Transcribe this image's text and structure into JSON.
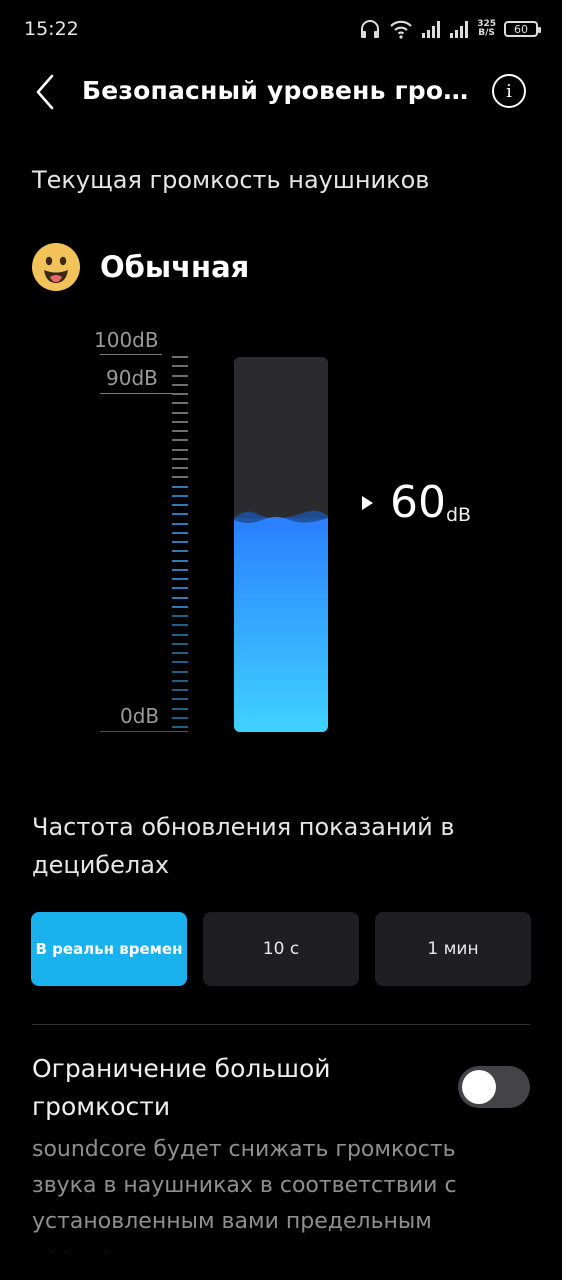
{
  "status_bar": {
    "time": "15:22",
    "speed_value": "325",
    "speed_unit": "B/S",
    "battery": "60"
  },
  "header": {
    "title": "Безопасный уровень громкости"
  },
  "current": {
    "label": "Текущая громкость наушников",
    "level_label": "Обычная",
    "value": "60",
    "unit": "dB",
    "fill_fraction": 0.57
  },
  "scale": {
    "max_label": "100dB",
    "mid_label": "90dB",
    "min_label": "0dB"
  },
  "frequency": {
    "title": "Частота обновления показаний в децибелах",
    "options": [
      "В реальн времен",
      "10 с",
      "1 мин"
    ],
    "selected": 0
  },
  "limit": {
    "title": "Ограничение большой громкости",
    "enabled": false,
    "description": "soundcore будет снижать громкость звука в наушниках в соответствии с установленным вами предельным уровнем."
  },
  "colors": {
    "accent": "#1ab2ee",
    "fill_top": "#2a80ff",
    "fill_bottom": "#3fd2ff",
    "face": "#f1c35a"
  }
}
